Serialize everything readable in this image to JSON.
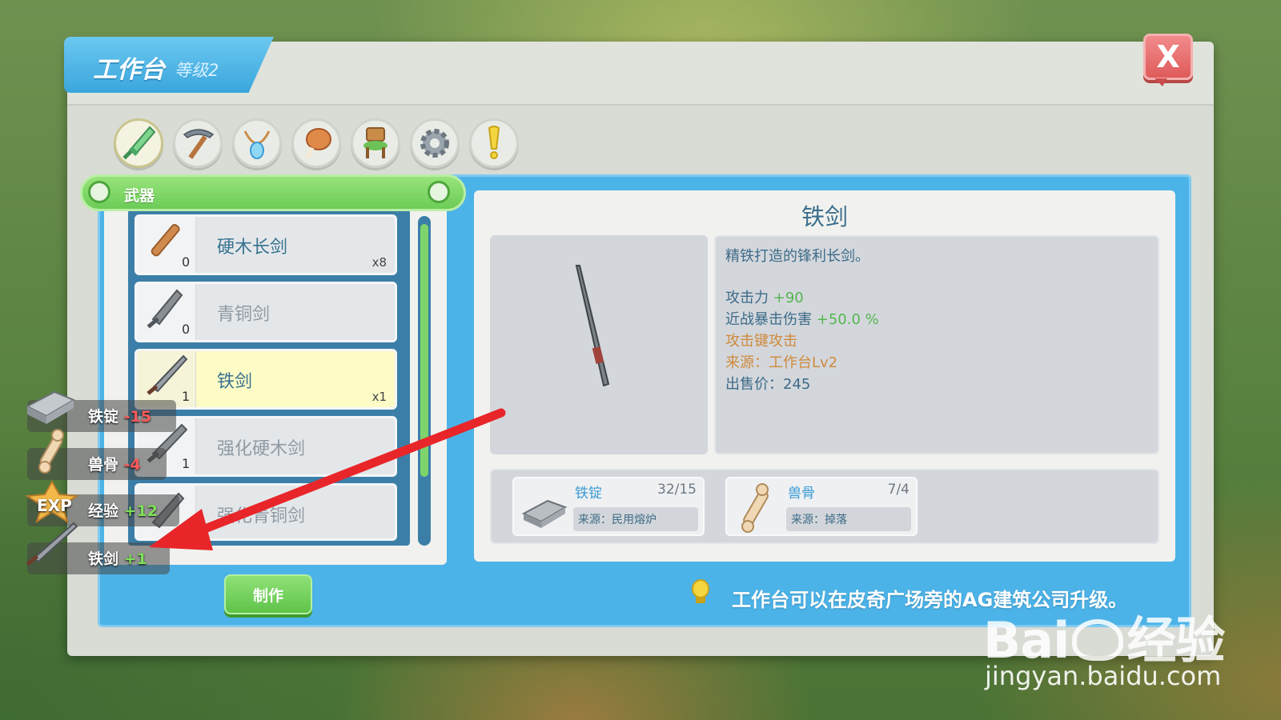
{
  "window": {
    "title": "工作台",
    "level": "等级2",
    "close_label": "X"
  },
  "categories": [
    {
      "icon": "sword-icon",
      "active": true
    },
    {
      "icon": "pickaxe-icon",
      "active": false
    },
    {
      "icon": "necklace-icon",
      "active": false
    },
    {
      "icon": "meat-icon",
      "active": false
    },
    {
      "icon": "chair-icon",
      "active": false
    },
    {
      "icon": "gear-icon",
      "active": false
    },
    {
      "icon": "exclamation-icon",
      "active": false
    }
  ],
  "category_label": "武器",
  "items": [
    {
      "name": "硬木长剑",
      "count": "0",
      "qty": "x8",
      "selected": false,
      "dim": false,
      "icon": "wooden-sword-icon"
    },
    {
      "name": "青铜剑",
      "count": "0",
      "qty": "",
      "selected": false,
      "dim": true,
      "icon": "bronze-sword-icon"
    },
    {
      "name": "铁剑",
      "count": "1",
      "qty": "x1",
      "selected": true,
      "dim": false,
      "icon": "iron-sword-icon"
    },
    {
      "name": "强化硬木剑",
      "count": "1",
      "qty": "",
      "selected": false,
      "dim": true,
      "icon": "reinforced-wood-sword-icon"
    },
    {
      "name": "强化青铜剑",
      "count": "",
      "qty": "",
      "selected": false,
      "dim": true,
      "icon": "reinforced-bronze-sword-icon"
    }
  ],
  "craft_button": "制作",
  "detail": {
    "title": "铁剑",
    "description": "精铁打造的锋利长剑。",
    "attack_label": "攻击力",
    "attack_value": "+90",
    "crit_label": "近战暴击伤害",
    "crit_value": "+50.0 %",
    "attack_key": "攻击键攻击",
    "source": "来源：工作台Lv2",
    "price": "出售价：245"
  },
  "materials": [
    {
      "name": "铁锭",
      "count": "32/15",
      "source": "来源：民用熔炉",
      "icon": "iron-ingot-icon"
    },
    {
      "name": "兽骨",
      "count": "7/4",
      "source": "来源：掉落",
      "icon": "bone-icon"
    }
  ],
  "hint": "工作台可以在皮奇广场旁的AG建筑公司升级。",
  "gains": [
    {
      "label": "铁锭",
      "value": "-15",
      "kind": "neg",
      "icon": "iron-ingot-icon"
    },
    {
      "label": "兽骨",
      "value": "-4",
      "kind": "neg",
      "icon": "bone-icon"
    },
    {
      "label": "经验",
      "value": "+12",
      "kind": "pos",
      "icon": "exp-icon"
    },
    {
      "label": "铁剑",
      "value": "+1",
      "kind": "pos",
      "icon": "iron-sword-icon"
    }
  ],
  "exp_badge": "EXP",
  "watermark": {
    "brand": "Bai",
    "brand2": "经验",
    "url": "jingyan.baidu.com"
  }
}
